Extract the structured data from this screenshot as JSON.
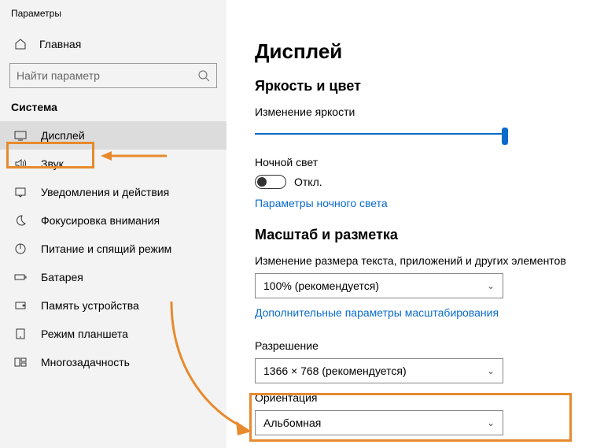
{
  "window_title": "Параметры",
  "sidebar": {
    "home": "Главная",
    "search_placeholder": "Найти параметр",
    "section": "Система",
    "items": [
      {
        "label": "Дисплей"
      },
      {
        "label": "Звук"
      },
      {
        "label": "Уведомления и действия"
      },
      {
        "label": "Фокусировка внимания"
      },
      {
        "label": "Питание и спящий режим"
      },
      {
        "label": "Батарея"
      },
      {
        "label": "Память устройства"
      },
      {
        "label": "Режим планшета"
      },
      {
        "label": "Многозадачность"
      }
    ]
  },
  "main": {
    "title": "Дисплей",
    "brightness_section": "Яркость и цвет",
    "brightness_label": "Изменение яркости",
    "night_light_label": "Ночной свет",
    "night_light_state": "Откл.",
    "night_light_link": "Параметры ночного света",
    "scale_section": "Масштаб и разметка",
    "scale_label": "Изменение размера текста, приложений и других элементов",
    "scale_value": "100% (рекомендуется)",
    "scale_link": "Дополнительные параметры масштабирования",
    "resolution_label": "Разрешение",
    "resolution_value": "1366 × 768 (рекомендуется)",
    "orientation_label": "Ориентация",
    "orientation_value": "Альбомная"
  }
}
